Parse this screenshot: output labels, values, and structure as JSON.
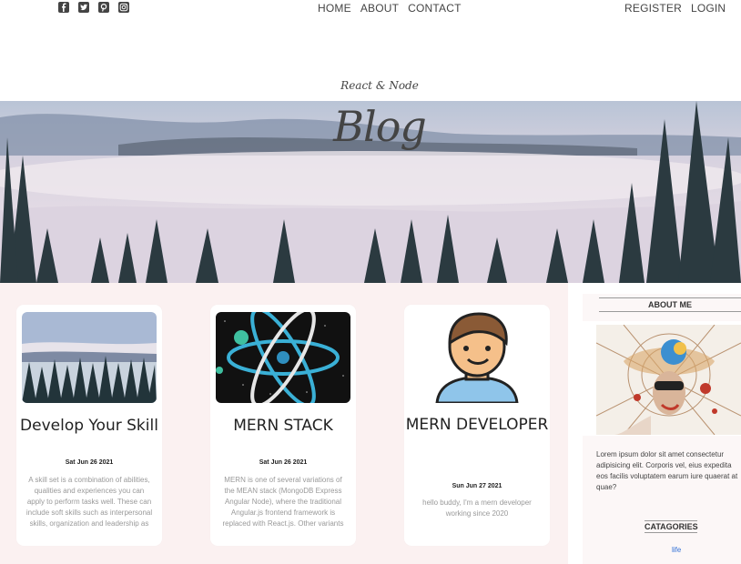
{
  "header": {
    "social_icons": [
      "facebook-icon",
      "twitter-icon",
      "pinterest-icon",
      "instagram-icon"
    ],
    "nav": [
      "HOME",
      "ABOUT",
      "CONTACT"
    ],
    "nav_right": [
      "REGISTER",
      "LOGIN"
    ]
  },
  "hero": {
    "subtitle": "React & Node",
    "title": "Blog"
  },
  "posts": [
    {
      "title": "Develop Your Skill",
      "date": "Sat Jun 26 2021",
      "excerpt": "A skill set is a combination of abilities, qualities and experiences you can apply to perform tasks well. These can include soft skills such as interpersonal skills, organization and leadership as well as..."
    },
    {
      "title": "MERN STACK",
      "date": "Sat Jun 26 2021",
      "excerpt": "MERN is one of several variations of the MEAN stack (MongoDB Express Angular Node), where the traditional Angular.js frontend framework is replaced with React.js. Other variants include MEVN (MongoDB,..."
    },
    {
      "title": "MERN DEVELOPER",
      "date": "Sun Jun 27 2021",
      "excerpt": "hello buddy, I'm a mern developer working since 2020"
    }
  ],
  "sidebar": {
    "about_title": "ABOUT ME",
    "about_text": "Lorem ipsum dolor sit amet consectetur adipisicing elit. Corporis vel, eius expedita eos facilis voluptatem earum iure quaerat at quae?",
    "categories_title": "CATAGORIES",
    "categories": [
      "life"
    ]
  },
  "colors": {
    "main_bg": "#fbf1f1",
    "link": "#2f6fd6",
    "text": "#444444"
  }
}
